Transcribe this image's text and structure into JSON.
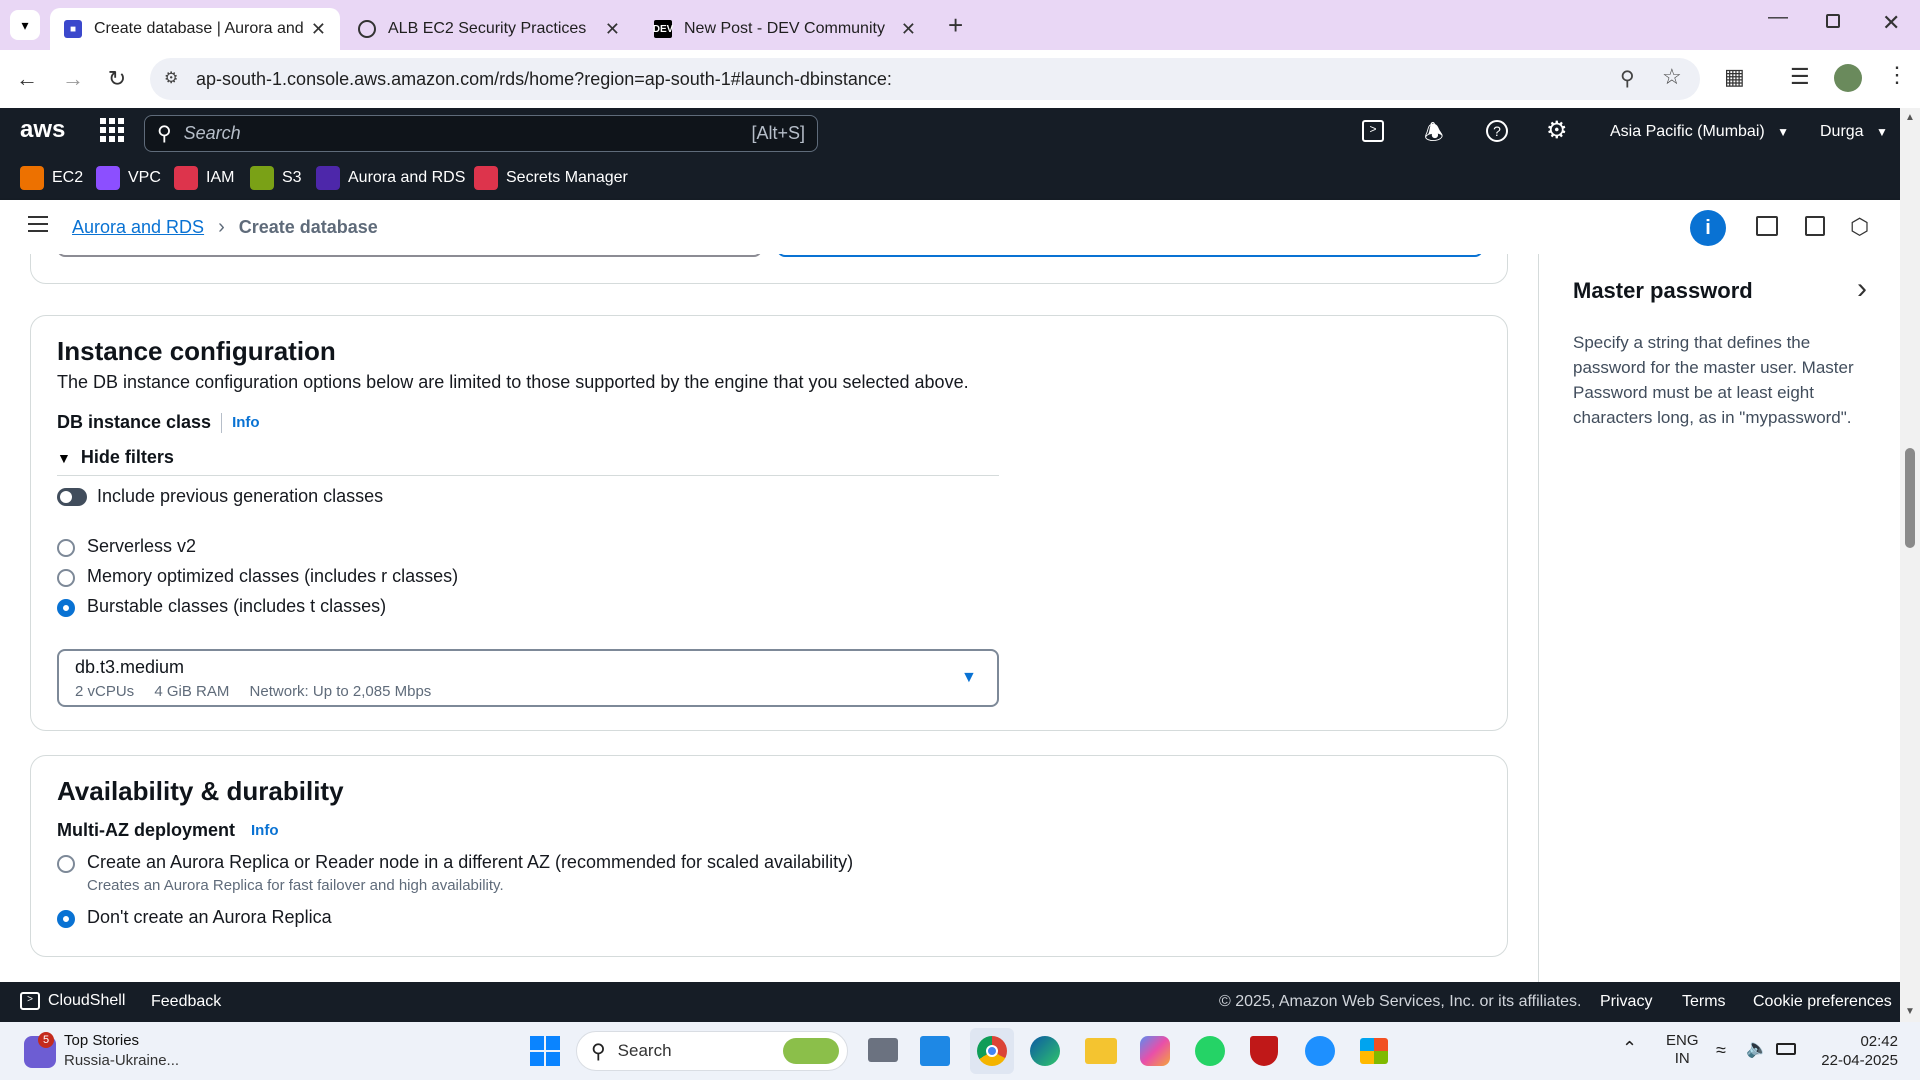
{
  "browser": {
    "tabs": [
      {
        "title": "Create database | Aurora and R",
        "favicon": "aws-rds-icon"
      },
      {
        "title": "ALB EC2 Security Practices",
        "favicon": "chatgpt-icon"
      },
      {
        "title": "New Post - DEV Community",
        "favicon": "dev-icon"
      }
    ],
    "url": "ap-south-1.console.aws.amazon.com/rds/home?region=ap-south-1#launch-dbinstance:"
  },
  "aws_nav": {
    "logo": "aws",
    "search_placeholder": "Search",
    "search_shortcut": "[Alt+S]",
    "region": "Asia Pacific (Mumbai)",
    "user": "Durga"
  },
  "favorites": [
    {
      "label": "EC2",
      "color": "#ed7100"
    },
    {
      "label": "VPC",
      "color": "#8c4fff"
    },
    {
      "label": "IAM",
      "color": "#dd344c"
    },
    {
      "label": "S3",
      "color": "#7aa116"
    },
    {
      "label": "Aurora and RDS",
      "color": "#4d27aa"
    },
    {
      "label": "Secrets Manager",
      "color": "#dd344c"
    }
  ],
  "breadcrumb": {
    "parent": "Aurora and RDS",
    "current": "Create database"
  },
  "instance_config": {
    "title": "Instance configuration",
    "description": "The DB instance configuration options below are limited to those supported by the engine that you selected above.",
    "class_label": "DB instance class",
    "info": "Info",
    "filters_toggle": "Hide filters",
    "include_prev_label": "Include previous generation classes",
    "options": [
      {
        "label": "Serverless v2",
        "selected": false
      },
      {
        "label": "Memory optimized classes (includes r classes)",
        "selected": false
      },
      {
        "label": "Burstable classes (includes t classes)",
        "selected": true
      }
    ],
    "selected_class": {
      "name": "db.t3.medium",
      "vcpus": "2 vCPUs",
      "ram": "4 GiB RAM",
      "network": "Network: Up to 2,085 Mbps"
    }
  },
  "availability": {
    "title": "Availability & durability",
    "label": "Multi-AZ deployment",
    "info": "Info",
    "options": [
      {
        "label": "Create an Aurora Replica or Reader node in a different AZ (recommended for scaled availability)",
        "description": "Creates an Aurora Replica for fast failover and high availability.",
        "selected": false
      },
      {
        "label": "Don't create an Aurora Replica",
        "description": "",
        "selected": true
      }
    ]
  },
  "help_panel": {
    "title": "Master password",
    "text": "Specify a string that defines the password for the master user. Master Password must be at least eight characters long, as in \"mypassword\"."
  },
  "footer": {
    "cloudshell": "CloudShell",
    "feedback": "Feedback",
    "copyright": "© 2025, Amazon Web Services, Inc. or its affiliates.",
    "privacy": "Privacy",
    "terms": "Terms",
    "cookies": "Cookie preferences"
  },
  "taskbar": {
    "news_title": "Top Stories",
    "news_sub": "Russia-Ukraine...",
    "news_badge": "5",
    "search": "Search",
    "lang1": "ENG",
    "lang2": "IN",
    "time": "02:42",
    "date": "22-04-2025"
  }
}
